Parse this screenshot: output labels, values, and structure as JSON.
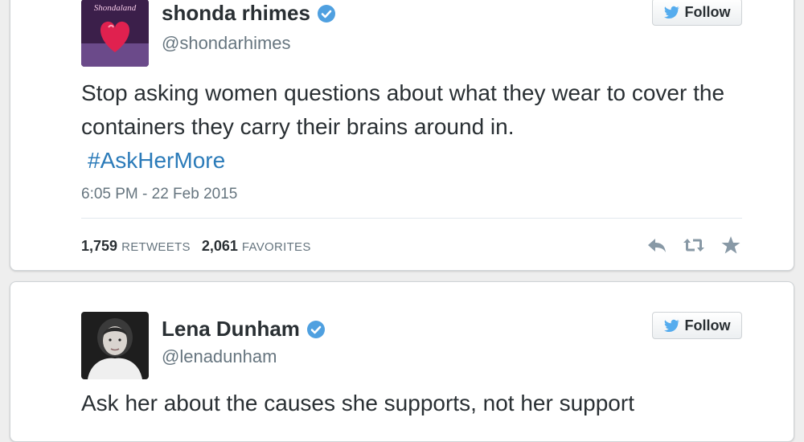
{
  "tweets": [
    {
      "display_name": "shonda rhimes",
      "handle": "@shondarhimes",
      "follow_label": "Follow",
      "avatar_text": "Shondaland",
      "text": "Stop asking women questions about what they wear to cover the containers they carry their brains around in.",
      "hashtag": "#AskHerMore",
      "timestamp": "6:05 PM - 22 Feb 2015",
      "retweet_count": "1,759",
      "retweet_label": "RETWEETS",
      "favorite_count": "2,061",
      "favorite_label": "FAVORITES"
    },
    {
      "display_name": "Lena Dunham",
      "handle": "@lenadunham",
      "follow_label": "Follow",
      "text": "Ask her about the causes she supports, not her support"
    }
  ],
  "icons": {
    "verified": "verified-badge-icon",
    "bird": "twitter-bird-icon",
    "reply": "reply-icon",
    "retweet": "retweet-icon",
    "favorite": "star-icon"
  },
  "colors": {
    "verified": "#4fa0e0",
    "bird": "#55acee",
    "hashtag": "#2b7bb9",
    "text": "#292f33",
    "muted": "#66757f",
    "action": "#8899a6"
  }
}
